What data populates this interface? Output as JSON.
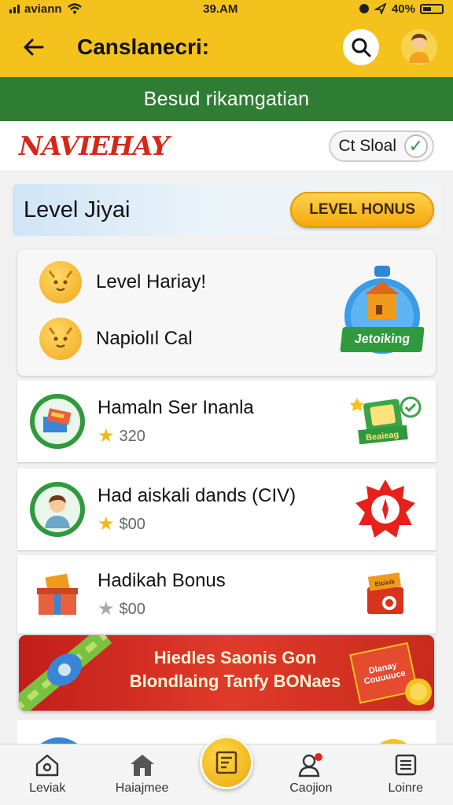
{
  "status_bar": {
    "carrier": "aviann",
    "time": "39.AM",
    "battery": "40%"
  },
  "app_bar": {
    "title": "Canslanecri:"
  },
  "banner": {
    "text": "Besud rikamgatian"
  },
  "brand": {
    "logo": "NAVIEHAY",
    "filter_label": "Ct Sloal"
  },
  "level": {
    "title": "Level Jiyai",
    "bonus_button": "LEVEL HONUS"
  },
  "top_card": {
    "rows": [
      "Level Hariay!",
      "Napiolıl Cal"
    ],
    "badge": "Jetoiking"
  },
  "items": [
    {
      "title": "Hamaln Ser Inanla",
      "value": "320",
      "side_label": "Beaieag"
    },
    {
      "title": "Had aiskali dands (CIV)",
      "value": "$00"
    },
    {
      "title": "Hadikah Bonus",
      "value": "$00",
      "side_label": "Eicicik"
    }
  ],
  "promo": {
    "line1": "Hiedles Saonis Gon",
    "line2": "Blondlaing Tanfy BONaes",
    "flag": "Dlanay Couuuuce"
  },
  "bottom_nav": [
    {
      "label": "Leviak",
      "icon": "home-outline-icon"
    },
    {
      "label": "Haiajmee",
      "icon": "home-filled-icon"
    },
    {
      "label": "Caojion",
      "icon": "profile-icon"
    },
    {
      "label": "Loinre",
      "icon": "list-icon"
    }
  ],
  "colors": {
    "primary": "#f4c21c",
    "banner_green": "#2e7d32",
    "brand_red": "#d62718",
    "promo_red": "#c21d1a"
  }
}
